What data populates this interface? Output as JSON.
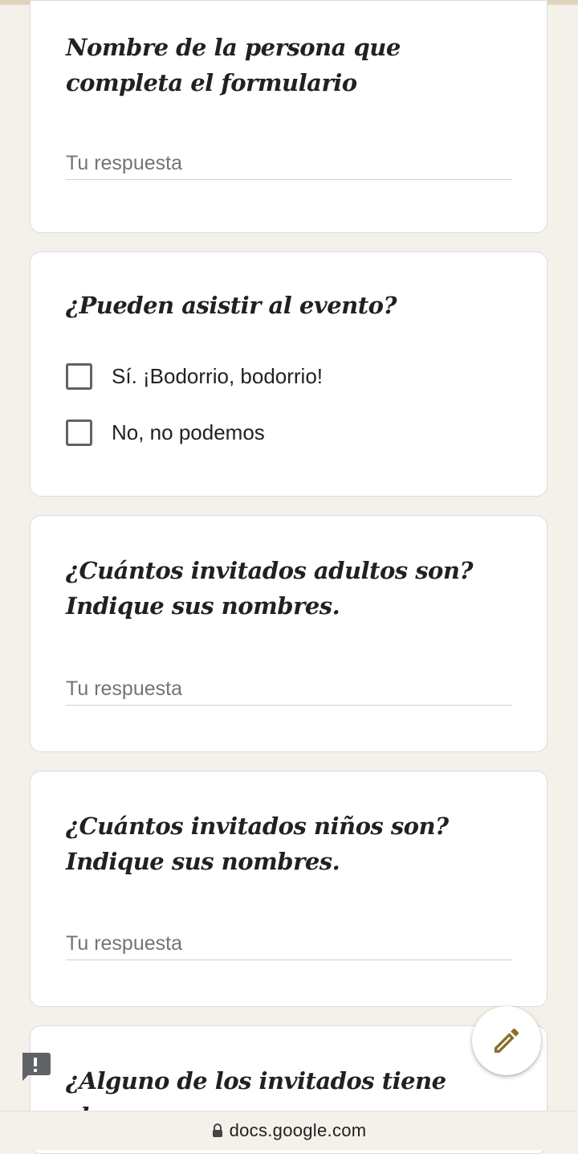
{
  "questions": [
    {
      "title": "Nombre de la persona que completa el formulario",
      "placeholder": "Tu respuesta"
    },
    {
      "title": "¿Pueden asistir al evento?",
      "options": [
        "Sí. ¡Bodorrio, bodorrio!",
        "No, no podemos"
      ]
    },
    {
      "title": "¿Cuántos invitados adultos son? Indique sus nombres.",
      "placeholder": "Tu respuesta"
    },
    {
      "title": "¿Cuántos invitados niños son? Indique sus nombres.",
      "placeholder": "Tu respuesta"
    },
    {
      "title": "¿Alguno de los invitados tiene alguna"
    }
  ],
  "fab": {
    "icon": "pencil-icon"
  },
  "report": {
    "icon": "report-issue-icon"
  },
  "browser": {
    "url": "docs.google.com",
    "lock_icon": "lock-icon"
  },
  "colors": {
    "accent": "#8a6d2b",
    "background": "#f4f0ea",
    "topbar": "#e0d3bd"
  }
}
